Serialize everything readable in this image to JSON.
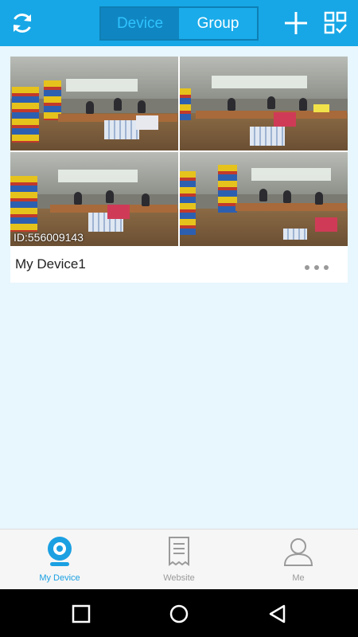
{
  "header": {
    "tabs": [
      {
        "label": "Device",
        "active": true
      },
      {
        "label": "Group",
        "active": false
      }
    ]
  },
  "device_card": {
    "id_text": "ID:556009143",
    "name": "My Device1"
  },
  "bottom_tabs": [
    {
      "label": "My Device",
      "icon": "camera-icon",
      "active": true
    },
    {
      "label": "Website",
      "icon": "receipt-icon",
      "active": false
    },
    {
      "label": "Me",
      "icon": "person-icon",
      "active": false
    }
  ],
  "colors": {
    "primary": "#17a7e6",
    "active_tab_text": "#1ba0e2",
    "background": "#e8f6fd"
  }
}
